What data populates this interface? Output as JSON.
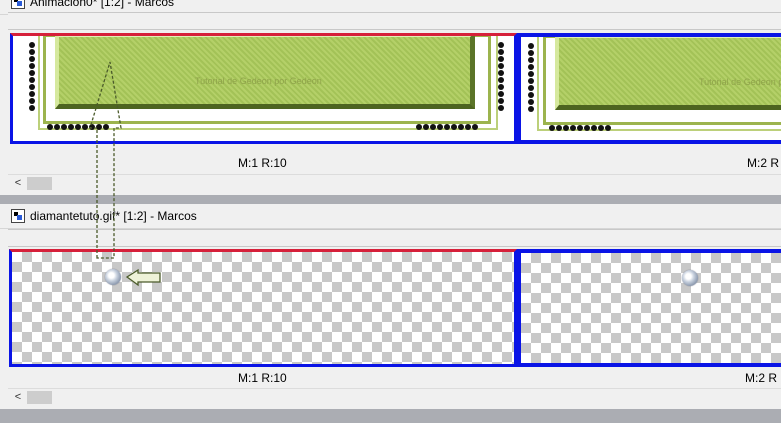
{
  "windows": [
    {
      "title": "Animacion0* [1:2] - Marcos",
      "frames": [
        {
          "label": "M:1  R:10",
          "selected": true
        },
        {
          "label": "M:2  R"
        }
      ],
      "frame_content": {
        "watermark": "Tutorial de Gedeon por Gedeon"
      }
    },
    {
      "title": "diamantetuto.gif* [1:2] - Marcos",
      "frames": [
        {
          "label": "M:1  R:10",
          "selected": true
        },
        {
          "label": "M:2  R"
        }
      ]
    }
  ],
  "scrollbar": {
    "left_arrow": "<"
  },
  "icons": [
    "document-icon",
    "diamond-icon",
    "arrow-icon",
    "left-arrow-icon"
  ],
  "colors": {
    "selected_top": "#d6203a",
    "frame_border": "#0a14e6",
    "green_frame": "#b4d068",
    "arrow": "#4a5a2a"
  }
}
